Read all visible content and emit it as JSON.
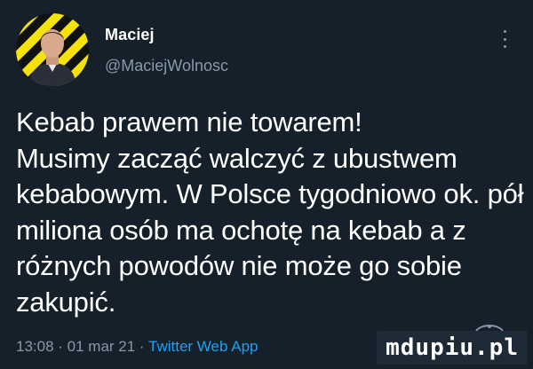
{
  "author": {
    "display_name": "Maciej",
    "handle": "@MaciejWolnosc"
  },
  "tweet": {
    "text": "Kebab prawem nie towarem!\nMusimy zacząć walczyć z ubustwem kebabowym. W Polsce tygodniowo ok. pół miliona osób ma ochotę na kebab a z różnych powodów nie może go sobie zakupić."
  },
  "meta": {
    "time": "13:08",
    "separator": " · ",
    "date": "01 mar 21",
    "source": "Twitter Web App"
  },
  "watermark": {
    "text": "mdupiu.pl"
  },
  "icons": {
    "more": "more-vertical-icon",
    "avatar": "avatar-image"
  },
  "colors": {
    "background": "#15202b",
    "text_primary": "#ffffff",
    "text_secondary": "#8899a6",
    "link": "#1da1f2",
    "avatar_stripe_yellow": "#f5e20a",
    "avatar_stripe_black": "#111111"
  }
}
